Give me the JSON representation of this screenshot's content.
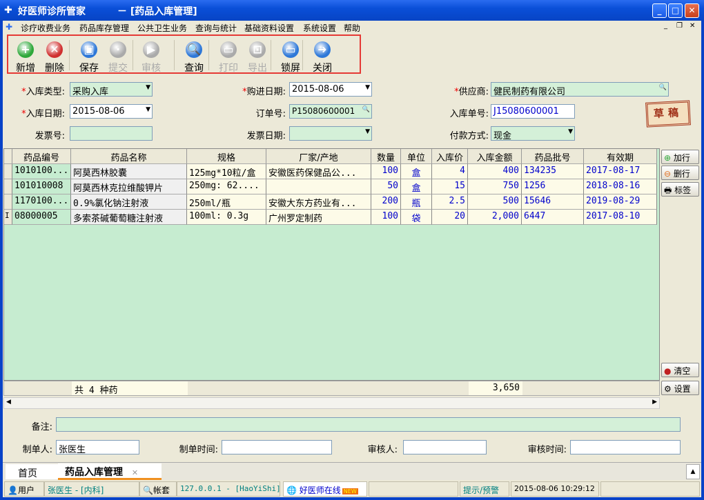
{
  "window": {
    "title": "好医师诊所管家",
    "subtitle": "－  [药品入库管理]"
  },
  "menu": [
    "诊疗收费业务",
    "药品库存管理",
    "公共卫生业务",
    "查询与统计",
    "基础资料设置",
    "系统设置",
    "帮助"
  ],
  "toolbar": [
    {
      "label": "新增",
      "icon": "plus-icon",
      "color": "#2ea83a",
      "enabled": true
    },
    {
      "label": "删除",
      "icon": "x-icon",
      "color": "#d03030",
      "enabled": true
    },
    {
      "label": "保存",
      "icon": "floppy-icon",
      "color": "#2e78d8",
      "enabled": true
    },
    {
      "label": "提交",
      "icon": "submit-icon",
      "color": "#aaa",
      "enabled": false
    },
    {
      "label": "审核",
      "icon": "audit-icon",
      "color": "#aaa",
      "enabled": false
    },
    {
      "label": "查询",
      "icon": "search-icon",
      "color": "#2e78d8",
      "enabled": true
    },
    {
      "label": "打印",
      "icon": "print-icon",
      "color": "#aaa",
      "enabled": false
    },
    {
      "label": "导出",
      "icon": "export-icon",
      "color": "#aaa",
      "enabled": false
    },
    {
      "label": "锁屏",
      "icon": "monitor-icon",
      "color": "#2e78d8",
      "enabled": true
    },
    {
      "label": "关闭",
      "icon": "exit-icon",
      "color": "#2e78d8",
      "enabled": true
    }
  ],
  "form": {
    "type_label": "入库类型:",
    "type": "采购入库",
    "buy_date_label": "购进日期:",
    "buy_date": "2015-08-06",
    "supplier_label": "供应商:",
    "supplier": "健民制药有限公司",
    "in_date_label": "入库日期:",
    "in_date": "2015-08-06",
    "order_label": "订单号:",
    "order": "P15080600001",
    "in_no_label": "入库单号:",
    "in_no": "J15080600001",
    "invoice_label": "发票号:",
    "invoice": "",
    "invoice_date_label": "发票日期:",
    "invoice_date": "",
    "pay_label": "付款方式:",
    "pay": "现金",
    "stamp": "草稿"
  },
  "grid": {
    "columns": [
      "药品编号",
      "药品名称",
      "规格",
      "厂家/产地",
      "数量",
      "单位",
      "入库价",
      "入库金额",
      "药品批号",
      "有效期"
    ],
    "rows": [
      [
        "1010100...",
        "阿莫西林胶囊",
        "125mg*10粒/盒",
        "安徽医药保健品公...",
        "100",
        "盒",
        "4",
        "400",
        "134235",
        "2017-08-17"
      ],
      [
        "101010008",
        "阿莫西林克拉维酸钾片",
        "250mg: 62....",
        "",
        "50",
        "盒",
        "15",
        "750",
        "1256",
        "2018-08-16"
      ],
      [
        "1170100...",
        "0.9%氯化钠注射液",
        "250ml/瓶",
        "安徽大东方药业有...",
        "200",
        "瓶",
        "2.5",
        "500",
        "15646",
        "2019-08-29"
      ],
      [
        "08000005",
        "多索茶碱葡萄糖注射液",
        "100ml: 0.3g",
        "广州罗定制药",
        "100",
        "袋",
        "20",
        "2,000",
        "6447",
        "2017-08-10"
      ]
    ],
    "row_marker": "I",
    "footer_count": "共 4 种药",
    "footer_total": "3,650"
  },
  "side_buttons": {
    "add_row": "加行",
    "del_row": "删行",
    "label": "标签",
    "clear": "清空",
    "settings": "设置"
  },
  "bottom": {
    "remark_label": "备注:",
    "remark": "",
    "maker_label": "制单人:",
    "maker": "张医生",
    "make_time_label": "制单时间:",
    "make_time": "",
    "auditor_label": "审核人:",
    "auditor": "",
    "audit_time_label": "审核时间:",
    "audit_time": ""
  },
  "tabs": [
    {
      "label": "首页"
    },
    {
      "label": "药品入库管理"
    }
  ],
  "status": {
    "user_label": "用户",
    "user": "张医生 - [内科]",
    "account_label": "帐套",
    "server": "127.0.0.1 - [HaoYiShi]",
    "online": "好医师在线",
    "new_badge": "NEW",
    "alert": "提示/预警",
    "datetime": "2015-08-06 10:29:12"
  }
}
